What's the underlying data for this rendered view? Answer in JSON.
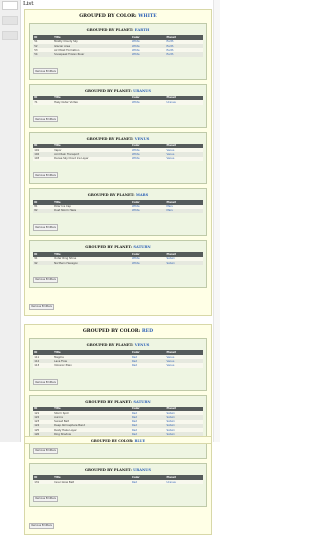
{
  "page": {
    "title": "List"
  },
  "button_label": "Remove Emitters",
  "columns": [
    "ID",
    "Title",
    "Color",
    "Planet"
  ],
  "colors": {
    "link": "#2b5fb5",
    "header_bg": "#555b5b",
    "color_group_bg": "#ffffe6",
    "planet_group_bg": "#eef5e2"
  },
  "color_groups": [
    {
      "label": "GROUPED BY COLOR:",
      "value": "WHITE",
      "planets": [
        {
          "label": "GROUPED BY PLANET:",
          "value": "EARTH",
          "rows": [
            [
              "51",
              "Mostly Cloudy Sky",
              "White",
              "Earth"
            ],
            [
              "52",
              "Glacier Area",
              "White",
              "Earth"
            ],
            [
              "53",
              "Air Moist Formation",
              "White",
              "Earth"
            ],
            [
              "54",
              "Snowpeak Frozen River",
              "White",
              "Earth"
            ]
          ]
        },
        {
          "label": "GROUPED BY PLANET:",
          "value": "URANUS",
          "rows": [
            [
              "71",
              "Hazy Outer Vortex",
              "White",
              "Uranus"
            ]
          ]
        },
        {
          "label": "GROUPED BY PLANET:",
          "value": "VENUS",
          "rows": [
            [
              "101",
              "Vapor",
              "White",
              "Venus"
            ],
            [
              "102",
              "Acid Rain Transport",
              "White",
              "Venus"
            ],
            [
              "103",
              "Dense Sky Cloud Ice Layer",
              "White",
              "Venus"
            ]
          ]
        },
        {
          "label": "GROUPED BY PLANET:",
          "value": "MARS",
          "rows": [
            [
              "81",
              "Polar Ice Cap",
              "White",
              "Mars"
            ],
            [
              "82",
              "Dust Storm Haze",
              "White",
              "Mars"
            ]
          ]
        },
        {
          "label": "GROUPED BY PLANET:",
          "value": "SATURN",
          "rows": [
            [
              "91",
              "Outer Ring Shine",
              "White",
              "Saturn"
            ],
            [
              "92",
              "Northern Hexagon",
              "White",
              "Saturn"
            ]
          ]
        }
      ]
    },
    {
      "label": "GROUPED BY COLOR:",
      "value": "RED",
      "planets": [
        {
          "label": "GROUPED BY PLANET:",
          "value": "VENUS",
          "rows": [
            [
              "111",
              "Magma",
              "Red",
              "Venus"
            ],
            [
              "112",
              "Lava Flow",
              "Red",
              "Venus"
            ],
            [
              "113",
              "Volcanic Plain",
              "Red",
              "Venus"
            ]
          ]
        },
        {
          "label": "GROUPED BY PLANET:",
          "value": "SATURN",
          "rows": [
            [
              "121",
              "Storm Spot",
              "Red",
              "Saturn"
            ],
            [
              "122",
              "Aurora",
              "Red",
              "Saturn"
            ],
            [
              "123",
              "Sunset Belt",
              "Red",
              "Saturn"
            ],
            [
              "124",
              "Deep Atmosphere Band",
              "Red",
              "Saturn"
            ],
            [
              "125",
              "Rusty Haze Layer",
              "Red",
              "Saturn"
            ],
            [
              "126",
              "Ring Shadow",
              "Red",
              "Saturn"
            ]
          ]
        },
        {
          "label": "GROUPED BY PLANET:",
          "value": "URANUS",
          "rows": [
            [
              "131",
              "Inner Glow Belt",
              "Red",
              "Uranus"
            ]
          ]
        }
      ]
    }
  ],
  "next_group_stub": {
    "label": "GROUPED BY COLOR:",
    "value": "BLUE"
  }
}
